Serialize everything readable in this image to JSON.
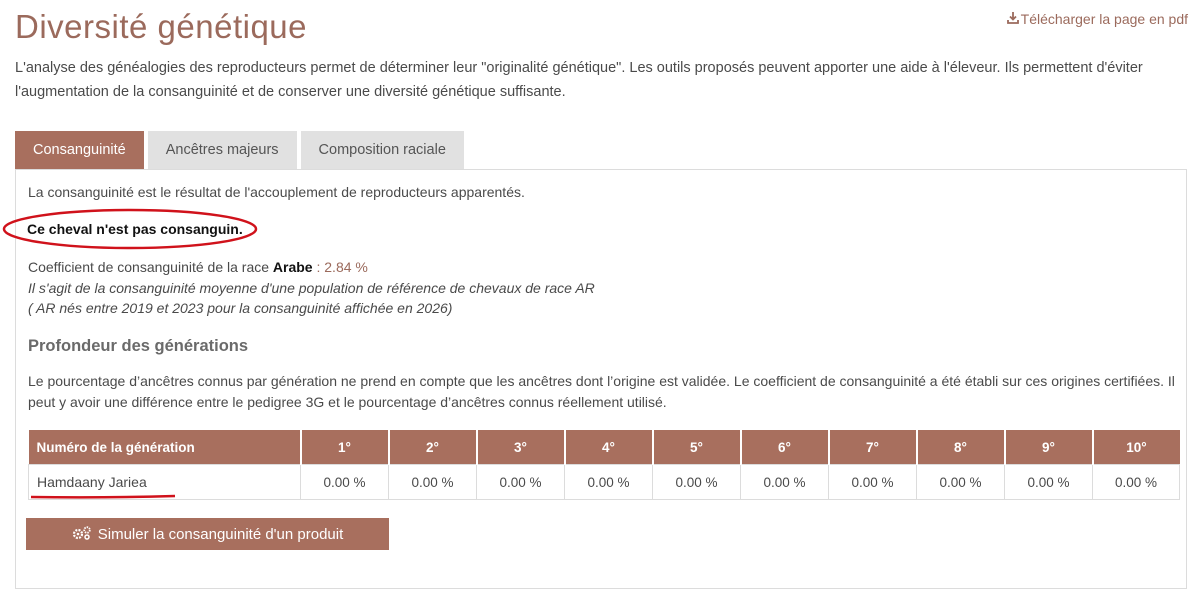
{
  "page": {
    "title": "Diversité génétique",
    "pdf_link": "Télécharger la page en pdf",
    "intro": "L'analyse des généalogies des reproducteurs permet de déterminer leur \"originalité génétique\". Les outils proposés peuvent apporter une aide à l'éleveur. Ils permettent d'éviter l'augmentation de la consanguinité et de conserver une diversité génétique suffisante."
  },
  "tabs": [
    {
      "label": "Consanguinité",
      "active": true
    },
    {
      "label": "Ancêtres majeurs",
      "active": false
    },
    {
      "label": "Composition raciale",
      "active": false
    }
  ],
  "consanguinite": {
    "definition": "La consanguinité est le résultat de l'accouplement de reproducteurs apparentés.",
    "verdict": "Ce cheval n'est pas consanguin.",
    "coef_prefix": "Coefficient de consanguinité de la race",
    "breed": "Arabe",
    "coef_value": ": 2.84 %",
    "note_line1": "Il s'agit de la consanguinité moyenne d'une population de référence de chevaux de race AR",
    "note_line2": "( AR nés entre 2019 et 2023 pour la consanguinité affichée en 2026)"
  },
  "depth": {
    "heading": "Profondeur des générations",
    "description": "Le pourcentage d’ancêtres connus par génération ne prend en compte que les ancêtres dont l’origine est validée. Le coefficient de consanguinité a été établi sur ces origines certifiées. Il peut y avoir une différence entre le pedigree 3G et le pourcentage d’ancêtres connus réellement utilisé.",
    "table": {
      "header_first": "Numéro de la génération",
      "generations": [
        "1°",
        "2°",
        "3°",
        "4°",
        "5°",
        "6°",
        "7°",
        "8°",
        "9°",
        "10°"
      ],
      "row": {
        "name": "Hamdaany Jariea",
        "values": [
          "0.00 %",
          "0.00 %",
          "0.00 %",
          "0.00 %",
          "0.00 %",
          "0.00 %",
          "0.00 %",
          "0.00 %",
          "0.00 %",
          "0.00 %"
        ]
      }
    }
  },
  "simulate_button": "Simuler la consanguinité d'un produit",
  "colors": {
    "accent": "#a86f5e",
    "title": "#9b6a5c",
    "annotation_red": "#d0121b"
  },
  "icons": {
    "pdf": "download-icon",
    "simulate": "gears-icon"
  }
}
